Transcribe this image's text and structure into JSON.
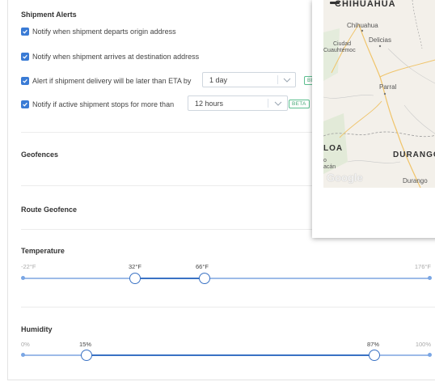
{
  "shipment_alerts": {
    "title": "Shipment Alerts",
    "items": [
      {
        "label": "Notify when shipment departs origin address",
        "checked": true
      },
      {
        "label": "Notify when shipment arrives at destination address",
        "checked": true
      },
      {
        "label": "Alert if shipment delivery will be later than ETA by",
        "checked": true,
        "select_value": "1 day",
        "badge": "BETA"
      },
      {
        "label": "Notify if active shipment stops for more than",
        "checked": true,
        "select_value": "12 hours",
        "badge": "BETA"
      }
    ]
  },
  "geofences": {
    "title": "Geofences"
  },
  "route_geofence": {
    "title": "Route Geofence"
  },
  "temperature": {
    "title": "Temperature",
    "min_label": "-22°F",
    "max_label": "176°F",
    "low_label": "32°F",
    "high_label": "66°F",
    "min": -22,
    "max": 176,
    "low": 32,
    "high": 66
  },
  "humidity": {
    "title": "Humidity",
    "min_label": "0%",
    "max_label": "100%",
    "low_label": "15%",
    "high_label": "87%",
    "min": 0,
    "max": 100,
    "low": 15,
    "high": 87
  },
  "map": {
    "labels": {
      "chihuahua_state": "CHIHUAHUA",
      "chihuahua_city": "Chihuahua",
      "delicias": "Delicias",
      "ciudad": "Ciudad",
      "cuauhtemoc": "Cuauhtémoc",
      "parral": "Parral",
      "sinaloa": "LOA",
      "durango_state": "DURANGO",
      "durango_city": "Durango",
      "t_partial": "T",
      "o_partial": "o",
      "acan_partial": "acán",
      "google": "Google"
    },
    "colors": {
      "road": "#f0c46a",
      "land": "#f3f0ea",
      "border": "#9a9a9a"
    }
  },
  "colors": {
    "accent": "#3a72c4",
    "checkbox": "#3a7bd5",
    "beta": "#46a877"
  }
}
